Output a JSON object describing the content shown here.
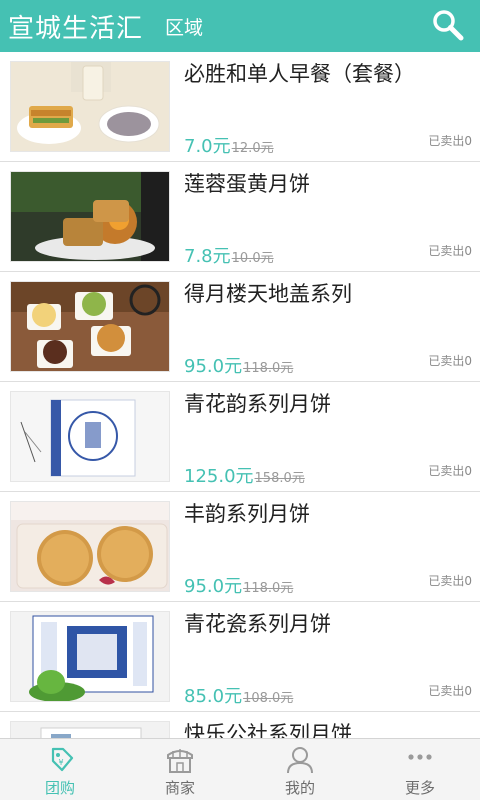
{
  "header": {
    "title": "宣城生活汇",
    "region_label": "区域",
    "search_icon": "search-icon"
  },
  "products": [
    {
      "name": "必胜和单人早餐（套餐）",
      "price": "7.0元",
      "original_price": "12.0元",
      "sold": "已卖出0"
    },
    {
      "name": "莲蓉蛋黄月饼",
      "price": "7.8元",
      "original_price": "10.0元",
      "sold": "已卖出0"
    },
    {
      "name": "得月楼天地盖系列",
      "price": "95.0元",
      "original_price": "118.0元",
      "sold": "已卖出0"
    },
    {
      "name": "青花韵系列月饼",
      "price": "125.0元",
      "original_price": "158.0元",
      "sold": "已卖出0"
    },
    {
      "name": "丰韵系列月饼",
      "price": "95.0元",
      "original_price": "118.0元",
      "sold": "已卖出0"
    },
    {
      "name": "青花瓷系列月饼",
      "price": "85.0元",
      "original_price": "108.0元",
      "sold": "已卖出0"
    },
    {
      "name": "快乐公社系列月饼",
      "price": "",
      "original_price": "",
      "sold": ""
    }
  ],
  "tabs": [
    {
      "label": "团购",
      "icon": "tag-icon",
      "active": true
    },
    {
      "label": "商家",
      "icon": "shop-icon",
      "active": false
    },
    {
      "label": "我的",
      "icon": "user-icon",
      "active": false
    },
    {
      "label": "更多",
      "icon": "more-icon",
      "active": false
    }
  ],
  "colors": {
    "accent": "#45c1b3",
    "text_primary": "#222222",
    "text_muted": "#8a8a8a",
    "tabbar_bg": "#f4f4f4"
  }
}
